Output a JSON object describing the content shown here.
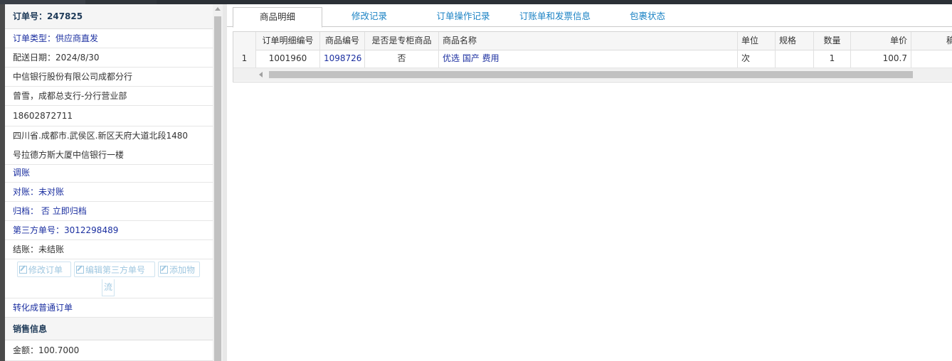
{
  "order_info": {
    "order_no": "订单号：247825",
    "order_type": "订单类型：供应商直发",
    "delivery_date": "配送日期：2024/8/30",
    "company": "中信银行股份有限公司成都分行",
    "contact": "曾雪，成都总支行-分行营业部",
    "phone": "18602872711",
    "address_line1": "四川省.成都市.武侯区.新区天府大道北段1480",
    "address_line2": "号拉德方斯大厦中信银行一楼",
    "adjust_link": "调账",
    "reconcile": "对账：未对账",
    "archive_label": "归档：",
    "archive_value": "否",
    "archive_now": "立即归档",
    "third_party_no": "第三方单号：3012298489",
    "settlement": "结账：未结账",
    "btn_edit_order": "修改订单",
    "btn_edit_third": "编辑第三方单号",
    "btn_add_logistics_a": "添加物",
    "btn_add_logistics_b": "流",
    "convert_link": "转化成普通订单",
    "sales_header": "销售信息",
    "amount": "金额：100.7000"
  },
  "tabs": [
    {
      "label": "商品明细",
      "active": true
    },
    {
      "label": "修改记录",
      "active": false
    },
    {
      "label": "订单操作记录",
      "active": false
    },
    {
      "label": "订账单和发票信息",
      "active": false
    },
    {
      "label": "包裹状态",
      "active": false
    }
  ],
  "grid": {
    "headers": [
      "",
      "订单明细编号",
      "商品编号",
      "是否是专柜商品",
      "商品名称",
      "单位",
      "规格",
      "数量",
      "单价",
      "稿"
    ],
    "rows": [
      [
        "1",
        "1001960",
        "1098726",
        "否",
        "优选 国产 费用",
        "次",
        "",
        "1",
        "100.7",
        ""
      ]
    ]
  },
  "colors": {
    "link": "#1b2fa0",
    "tab_link": "#1a82c4",
    "disabled_button": "#9fc7e0"
  }
}
